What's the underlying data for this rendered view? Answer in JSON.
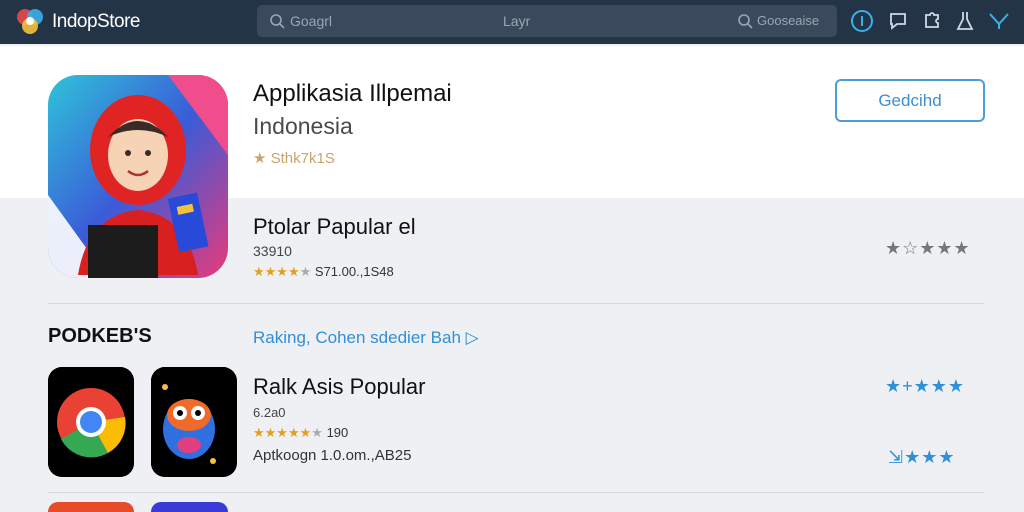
{
  "header": {
    "brand": "IndopStore",
    "search_left": "Goagrl",
    "search_center": "Layr",
    "search_right": "Gooseaise"
  },
  "hero": {
    "title": "Applikasia Illpemai",
    "subtitle": "Indonesia",
    "rating_text": "Sthk7k1S",
    "get_label": "Gedcihd"
  },
  "popular": {
    "title": "Ptolar Papular el",
    "count": "33910",
    "rating_text": "S71.00.,1S48",
    "right_stars": "★☆★★★"
  },
  "section": {
    "title": "PODKEB'S",
    "link": "Raking, Cohen sdedier Bah"
  },
  "row": {
    "title": "Ralk Asis Popular",
    "size": "6.2a0",
    "rating_count": "190",
    "meta": "Aptkoogn 1.0.om.,AB25",
    "stars_top": "★+★★★",
    "stars_bottom": "⇲★★★"
  },
  "colors": {
    "topbar": "#243447",
    "accent": "#2f8fd8",
    "star_gold": "#e0a020"
  },
  "icons": [
    "logo-icon",
    "search-icon",
    "info-icon",
    "chat-icon",
    "puzzle-icon",
    "flask-icon",
    "filter-icon",
    "chrome-icon",
    "monster-icon"
  ]
}
